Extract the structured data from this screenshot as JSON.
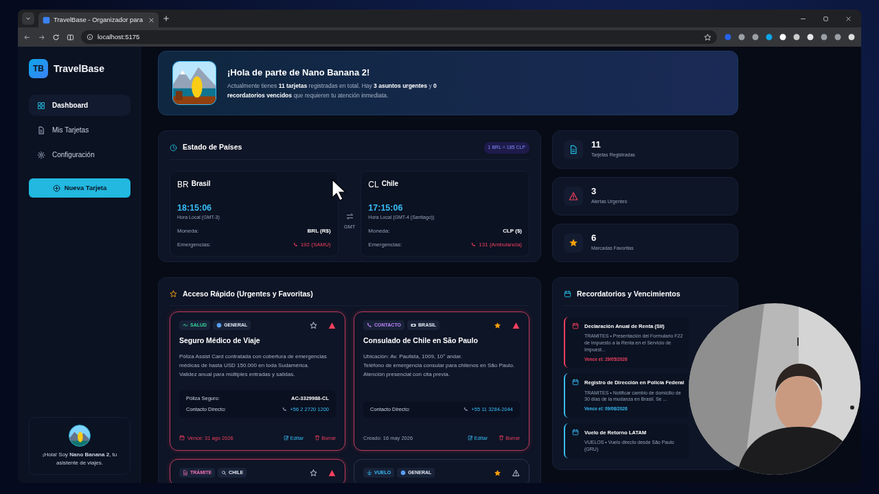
{
  "browser": {
    "tab_title": "TravelBase - Organizador para",
    "address": "localhost:5175"
  },
  "sidebar": {
    "logo": "TB",
    "brand": "TravelBase",
    "items": [
      {
        "label": "Dashboard",
        "kind": "grid",
        "selected": true
      },
      {
        "label": "Mis Tarjetas",
        "kind": "doc",
        "selected": false
      },
      {
        "label": "Configuración",
        "kind": "gear",
        "selected": false
      }
    ],
    "new_button": "Nueva Tarjeta",
    "assistant": "¡Hola! Soy **Nano Banana 2**, tu asistente de viajes."
  },
  "greeting": {
    "title": "¡Hola de parte de Nano Banana 2!",
    "text": "Actualmente tienes **11 tarjetas** registradas en total. Hay **3 asuntos urgentes** y **0 recordatorios vencidos** que requieren tu atención inmediata."
  },
  "countries": {
    "title": "Estado de Países",
    "rate": "1 BRL = 185 CLP",
    "gmt": "GMT",
    "items": [
      {
        "code": "BR",
        "name": "Brasil",
        "time": "18:15:06",
        "zone": "Hora Local (GMT-3)",
        "currency_label": "Moneda:",
        "currency": "BRL (R$)",
        "emergency_label": "Emergencias:",
        "emergency": "192 (SAMU)"
      },
      {
        "code": "CL",
        "name": "Chile",
        "time": "17:15:06",
        "zone": "Hora Local (GMT-4 (Santiago))",
        "currency_label": "Moneda:",
        "currency": "CLP ($)",
        "emergency_label": "Emergencias:",
        "emergency": "131 (Ambulancia)"
      }
    ]
  },
  "stats": [
    {
      "value": "11",
      "label": "Tarjetas Registradas",
      "kind": "doc"
    },
    {
      "value": "3",
      "label": "Alertas Urgentes",
      "kind": "alert"
    },
    {
      "value": "6",
      "label": "Marcadas Favoritas",
      "kind": "star"
    }
  ],
  "quick_access": {
    "title": "Acceso Rápido (Urgentes y Favoritas)",
    "cards": [
      {
        "tags": [
          {
            "label": "SALUD",
            "kind": "pulse",
            "color": "#34d399"
          },
          {
            "label": "GENERAL",
            "kind": "globe",
            "color": "#e2e8f0"
          }
        ],
        "favorite": false,
        "urgent": true,
        "title": "Seguro Médico de Viaje",
        "description": [
          "Póliza Assist Card contratada con cobertura de emergencias médicas de hasta USD 150.000 en toda Sudamérica.",
          "Validez anual para múltiples entradas y salidas."
        ],
        "fields": [
          {
            "label": "Póliza Seguro:",
            "value": "AC-3329988-CL",
            "kind": "text"
          },
          {
            "label": "Contacto Directo:",
            "value": "+56 2 2720 1200",
            "kind": "phone"
          }
        ],
        "footer": {
          "kind": "due",
          "text": "Vence: 31 ago 2026"
        },
        "edit": "Editar",
        "delete": "Borrar"
      },
      {
        "tags": [
          {
            "label": "CONTACTO",
            "kind": "phone",
            "color": "#c084fc"
          },
          {
            "label": "BRASIL",
            "kind": "flag",
            "color": "#e2e8f0"
          }
        ],
        "favorite": true,
        "urgent": true,
        "title": "Consulado de Chile en São Paulo",
        "description": [
          "Ubicación: Av. Paulista, 1009, 10° andar.",
          "Teléfono de emergencia consular para chilenos en São Paulo.",
          "Atención presencial con cita previa."
        ],
        "fields": [
          {
            "label": "Contacto Directo:",
            "value": "+55 11 3284-2044",
            "kind": "phone"
          }
        ],
        "footer": {
          "kind": "created",
          "text": "Creado: 16 may 2026"
        },
        "edit": "Editar",
        "delete": "Borrar"
      },
      {
        "tags": [
          {
            "label": "TRÁMITE",
            "kind": "doc",
            "color": "#f472b6"
          },
          {
            "label": "CHILE",
            "kind": "pin",
            "color": "#e2e8f0"
          }
        ],
        "favorite": false,
        "urgent": true
      },
      {
        "tags": [
          {
            "label": "VUELO",
            "kind": "plane",
            "color": "#38bdf8"
          },
          {
            "label": "GENERAL",
            "kind": "globe",
            "color": "#e2e8f0"
          }
        ],
        "favorite": true,
        "urgent": false
      }
    ]
  },
  "reminders": {
    "title": "Recordatorios y Vencimientos",
    "items": [
      {
        "title": "Declaración Anual de Renta (SII)",
        "text": "TRAMITES • Presentación del Formulario F22 de Impuesto a la Renta en el Servicio de Impuest...",
        "due": "Vence el: 29/05/2026",
        "color": "#f43f5e"
      },
      {
        "title": "Registro de Dirección en Policía Federal",
        "text": "TRAMITES • Notificar cambio de domicilio de 30 días de la mudanza en Brasil. Se ...",
        "due": "Vence el: 09/06/2026",
        "color": "#38bdf8"
      },
      {
        "title": "Vuelo de Retorno LATAM",
        "text": "VUELOS • Vuelo directo desde São Paulo (GRU)",
        "color": "#38bdf8"
      }
    ]
  }
}
